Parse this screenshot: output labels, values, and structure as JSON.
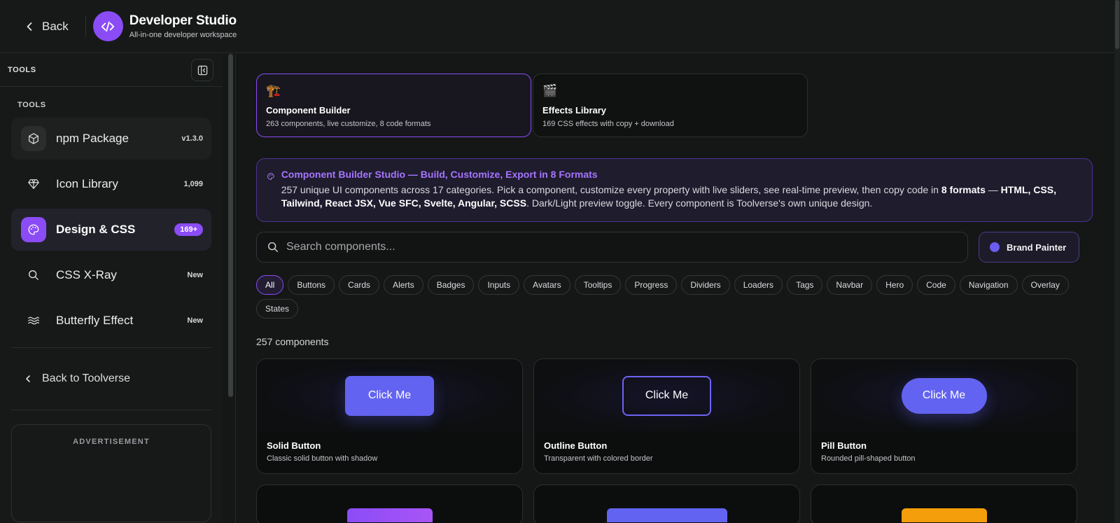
{
  "header": {
    "back_label": "Back",
    "title": "Developer Studio",
    "subtitle": "All-in-one developer workspace"
  },
  "sidebar": {
    "top_label": "TOOLS",
    "section_label": "TOOLS",
    "items": [
      {
        "label": "npm Package",
        "badge": "v1.3.0",
        "icon": "package-icon"
      },
      {
        "label": "Icon Library",
        "badge": "1,099",
        "icon": "diamond-icon"
      },
      {
        "label": "Design & CSS",
        "badge": "169+",
        "icon": "palette-icon"
      },
      {
        "label": "CSS X-Ray",
        "badge": "New",
        "icon": "search-icon"
      },
      {
        "label": "Butterfly Effect",
        "badge": "New",
        "icon": "waves-icon"
      }
    ],
    "back_label": "Back to Toolverse",
    "ad_label": "ADVERTISEMENT"
  },
  "tools": [
    {
      "emoji": "🏗️",
      "title": "Component Builder",
      "sub": "263 components, live customize, 8 code formats"
    },
    {
      "emoji": "🎬",
      "title": "Effects Library",
      "sub": "169 CSS effects with copy + download"
    }
  ],
  "banner": {
    "title": "Component Builder Studio — Build, Customize, Export in 8 Formats",
    "text_1": "257 unique UI components across 17 categories. Pick a component, customize every property with live sliders, see real-time preview, then copy code in ",
    "bold_1": "8 formats",
    "text_2": " — ",
    "bold_2": "HTML, CSS, Tailwind, React JSX, Vue SFC, Svelte, Angular, SCSS",
    "text_3": ". Dark/Light preview toggle. Every component is Toolverse's own unique design."
  },
  "search": {
    "placeholder": "Search components..."
  },
  "brand_painter_label": "Brand Painter",
  "filters": [
    "All",
    "Buttons",
    "Cards",
    "Alerts",
    "Badges",
    "Inputs",
    "Avatars",
    "Tooltips",
    "Progress",
    "Dividers",
    "Loaders",
    "Tags",
    "Navbar",
    "Hero",
    "Code",
    "Navigation",
    "Overlay",
    "States"
  ],
  "count_label": "257 components",
  "components": [
    {
      "preview_label": "Click Me",
      "name": "Solid Button",
      "desc": "Classic solid button with shadow"
    },
    {
      "preview_label": "Click Me",
      "name": "Outline Button",
      "desc": "Transparent with colored border"
    },
    {
      "preview_label": "Click Me",
      "name": "Pill Button",
      "desc": "Rounded pill-shaped button"
    }
  ],
  "colors": {
    "accent": "#8b4cf6",
    "button": "#6363f1",
    "orange": "#f59e0b"
  }
}
